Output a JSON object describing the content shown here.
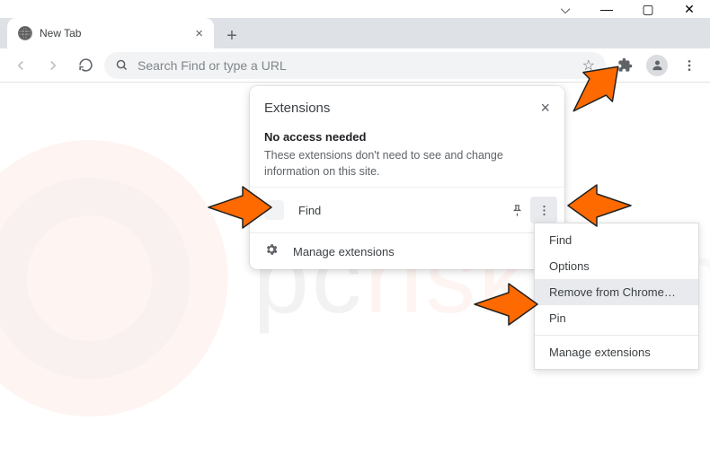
{
  "window": {
    "tab_title": "New Tab",
    "controls": {
      "min": "—",
      "max": "▢",
      "close": "✕",
      "dropdown": "⌵"
    }
  },
  "toolbar": {
    "omnibox_placeholder": "Search Find or type a URL",
    "icons": {
      "back": "back-icon",
      "forward": "forward-icon",
      "reload": "reload-icon",
      "search": "search-icon",
      "star": "star-icon",
      "extensions": "puzzle-icon",
      "profile": "profile-icon",
      "menu": "kebab-icon"
    }
  },
  "ext_popup": {
    "title": "Extensions",
    "heading": "No access needed",
    "desc": "These extensions don't need to see and change information on this site.",
    "item_name": "Find",
    "footer_label": "Manage extensions"
  },
  "ctx_menu": {
    "items": [
      "Find",
      "Options",
      "Remove from Chrome…",
      "Pin",
      "Manage extensions"
    ],
    "highlighted_index": 2
  },
  "watermark": {
    "prefix": "pc",
    "mid": "risk",
    "suffix": ".com"
  }
}
